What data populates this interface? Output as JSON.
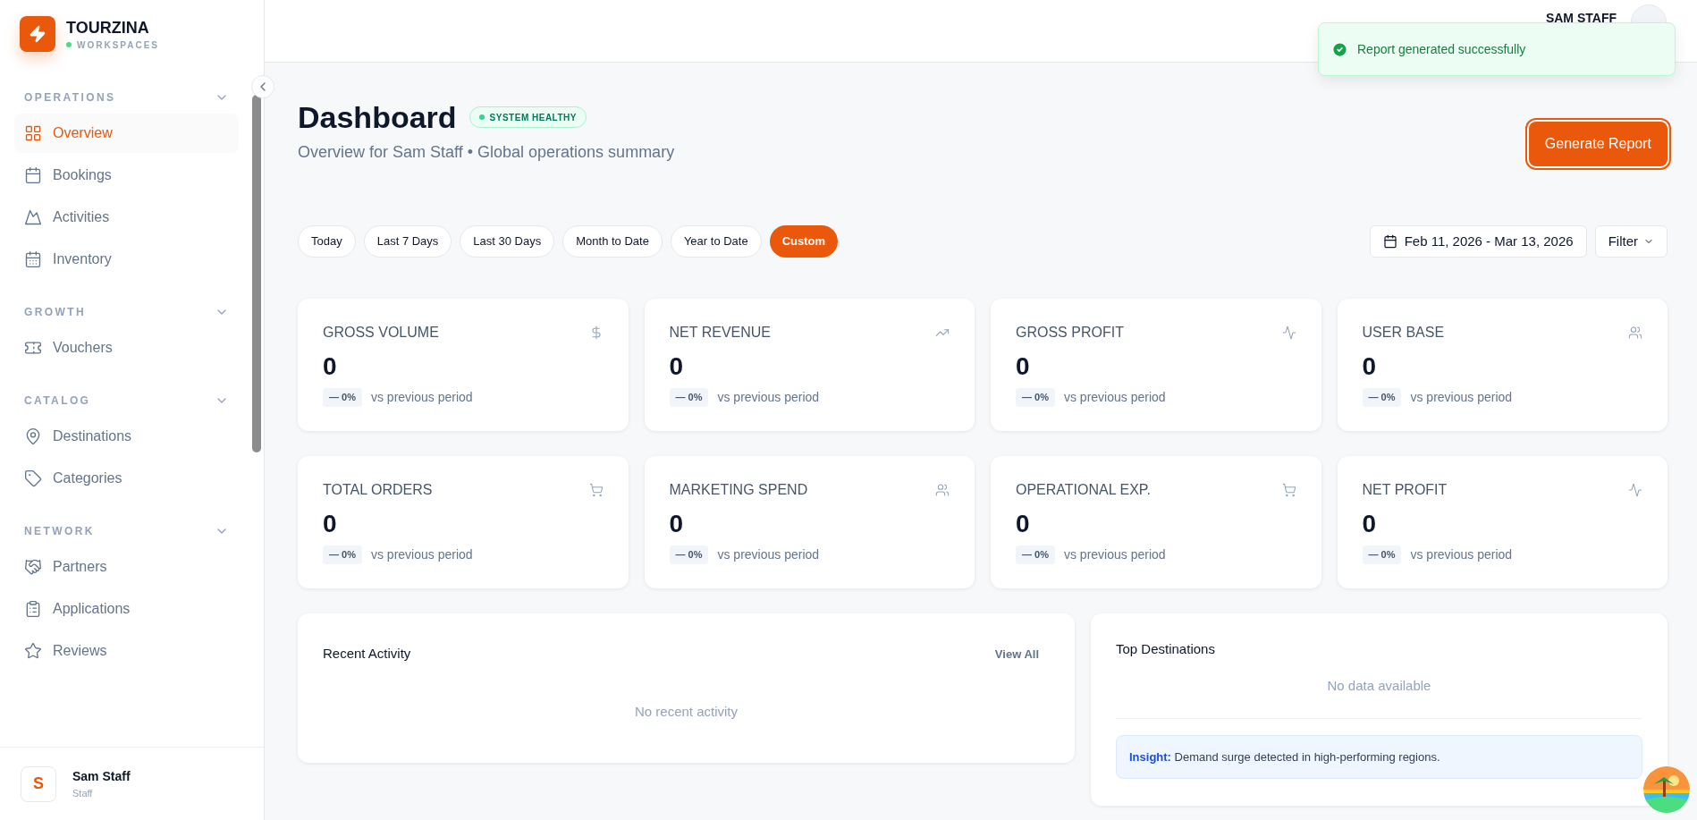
{
  "brand": {
    "name": "TOURZINA",
    "subtitle": "WORKSPACES"
  },
  "sidebar": {
    "sections": [
      {
        "title": "OPERATIONS",
        "expanded": true,
        "items": [
          {
            "label": "Overview",
            "selected": true
          },
          {
            "label": "Bookings",
            "selected": false
          },
          {
            "label": "Activities",
            "selected": false
          },
          {
            "label": "Inventory",
            "selected": false
          }
        ]
      },
      {
        "title": "GROWTH",
        "expanded": true,
        "items": [
          {
            "label": "Vouchers",
            "selected": false
          }
        ]
      },
      {
        "title": "CATALOG",
        "expanded": true,
        "items": [
          {
            "label": "Destinations",
            "selected": false
          },
          {
            "label": "Categories",
            "selected": false
          }
        ]
      },
      {
        "title": "NETWORK",
        "expanded": true,
        "items": [
          {
            "label": "Partners",
            "selected": false
          },
          {
            "label": "Applications",
            "selected": false
          },
          {
            "label": "Reviews",
            "selected": false
          }
        ]
      }
    ],
    "user": {
      "initial": "S",
      "name": "Sam Staff",
      "role": "Staff"
    }
  },
  "header": {
    "user_name": "SAM STAFF"
  },
  "toast": {
    "message": "Report generated successfully"
  },
  "page": {
    "title": "Dashboard",
    "status_badge": "SYSTEM HEALTHY",
    "subtitle": "Overview for Sam Staff • Global operations summary",
    "primary_button": "Generate Report"
  },
  "date_ranges": [
    {
      "label": "Today",
      "selected": false
    },
    {
      "label": "Last 7 Days",
      "selected": false
    },
    {
      "label": "Last 30 Days",
      "selected": false
    },
    {
      "label": "Month to Date",
      "selected": false
    },
    {
      "label": "Year to Date",
      "selected": false
    },
    {
      "label": "Custom",
      "selected": true
    }
  ],
  "date_picker": {
    "value": "Feb 11, 2026 - Mar 13, 2026"
  },
  "filter_button": "Filter",
  "metrics": [
    {
      "label": "GROSS VOLUME",
      "value": "0",
      "change": "— 0%",
      "note": "vs previous period"
    },
    {
      "label": "NET REVENUE",
      "value": "0",
      "change": "— 0%",
      "note": "vs previous period"
    },
    {
      "label": "GROSS PROFIT",
      "value": "0",
      "change": "— 0%",
      "note": "vs previous period"
    },
    {
      "label": "USER BASE",
      "value": "0",
      "change": "— 0%",
      "note": "vs previous period"
    },
    {
      "label": "TOTAL ORDERS",
      "value": "0",
      "change": "— 0%",
      "note": "vs previous period"
    },
    {
      "label": "MARKETING SPEND",
      "value": "0",
      "change": "— 0%",
      "note": "vs previous period"
    },
    {
      "label": "OPERATIONAL EXP.",
      "value": "0",
      "change": "— 0%",
      "note": "vs previous period"
    },
    {
      "label": "NET PROFIT",
      "value": "0",
      "change": "— 0%",
      "note": "vs previous period"
    }
  ],
  "recent_activity": {
    "title": "Recent Activity",
    "link": "View All",
    "empty": "No recent activity"
  },
  "top_destinations": {
    "title": "Top Destinations",
    "empty": "No data available",
    "insight": "**Insight:** Demand surge detected in high-performing regions."
  }
}
